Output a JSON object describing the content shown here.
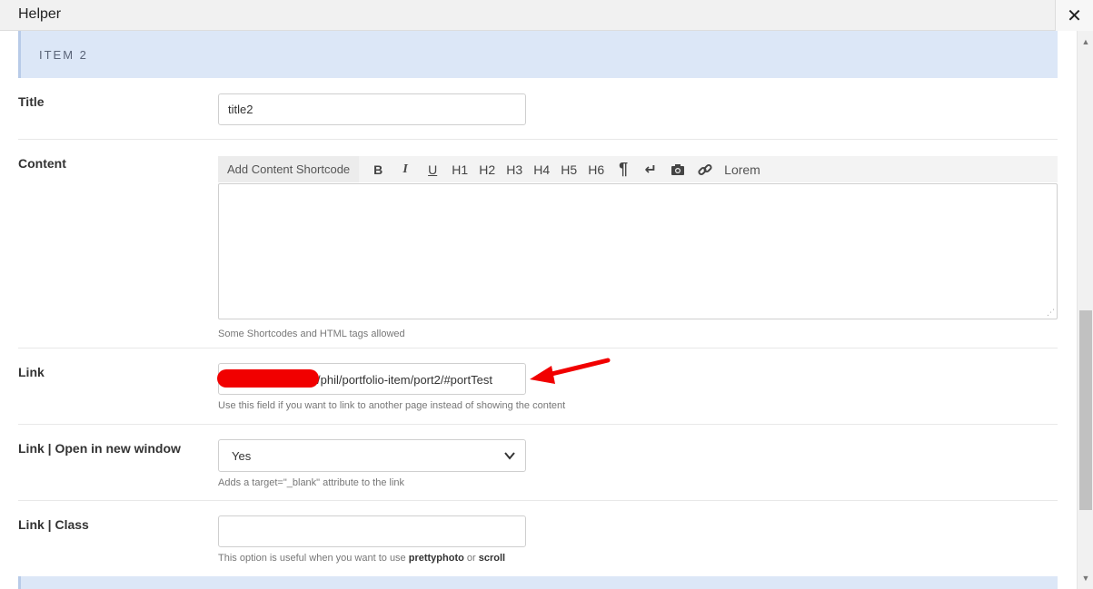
{
  "window": {
    "title": "Helper",
    "close_glyph": "✕"
  },
  "section": {
    "title": "ITEM 2"
  },
  "fields": {
    "title": {
      "label": "Title",
      "value": "title2"
    },
    "content": {
      "label": "Content",
      "toolbar": {
        "shortcode_label": "Add Content Shortcode",
        "bold": "B",
        "italic": "I",
        "underline": "U",
        "h1": "H1",
        "h2": "H2",
        "h3": "H3",
        "h4": "H4",
        "h5": "H5",
        "h6": "H6",
        "paragraph": "¶",
        "linebreak": "↵",
        "lorem": "Lorem"
      },
      "value": "",
      "description": "Some Shortcodes and HTML tags allowed"
    },
    "link": {
      "label": "Link",
      "value": "/phil/portfolio-item/port2/#portTest",
      "description": "Use this field if you want to link to another page instead of showing the content"
    },
    "link_new_window": {
      "label": "Link | Open in new window",
      "selected": "Yes",
      "description": "Adds a target=\"_blank\" attribute to the link"
    },
    "link_class": {
      "label": "Link | Class",
      "value": "",
      "description_prefix": "This option is useful when you want to use ",
      "description_b1": "prettyphoto",
      "description_mid": " or ",
      "description_b2": "scroll"
    }
  },
  "colors": {
    "section_bg": "#dce7f7",
    "annotation_red": "#f10000"
  }
}
